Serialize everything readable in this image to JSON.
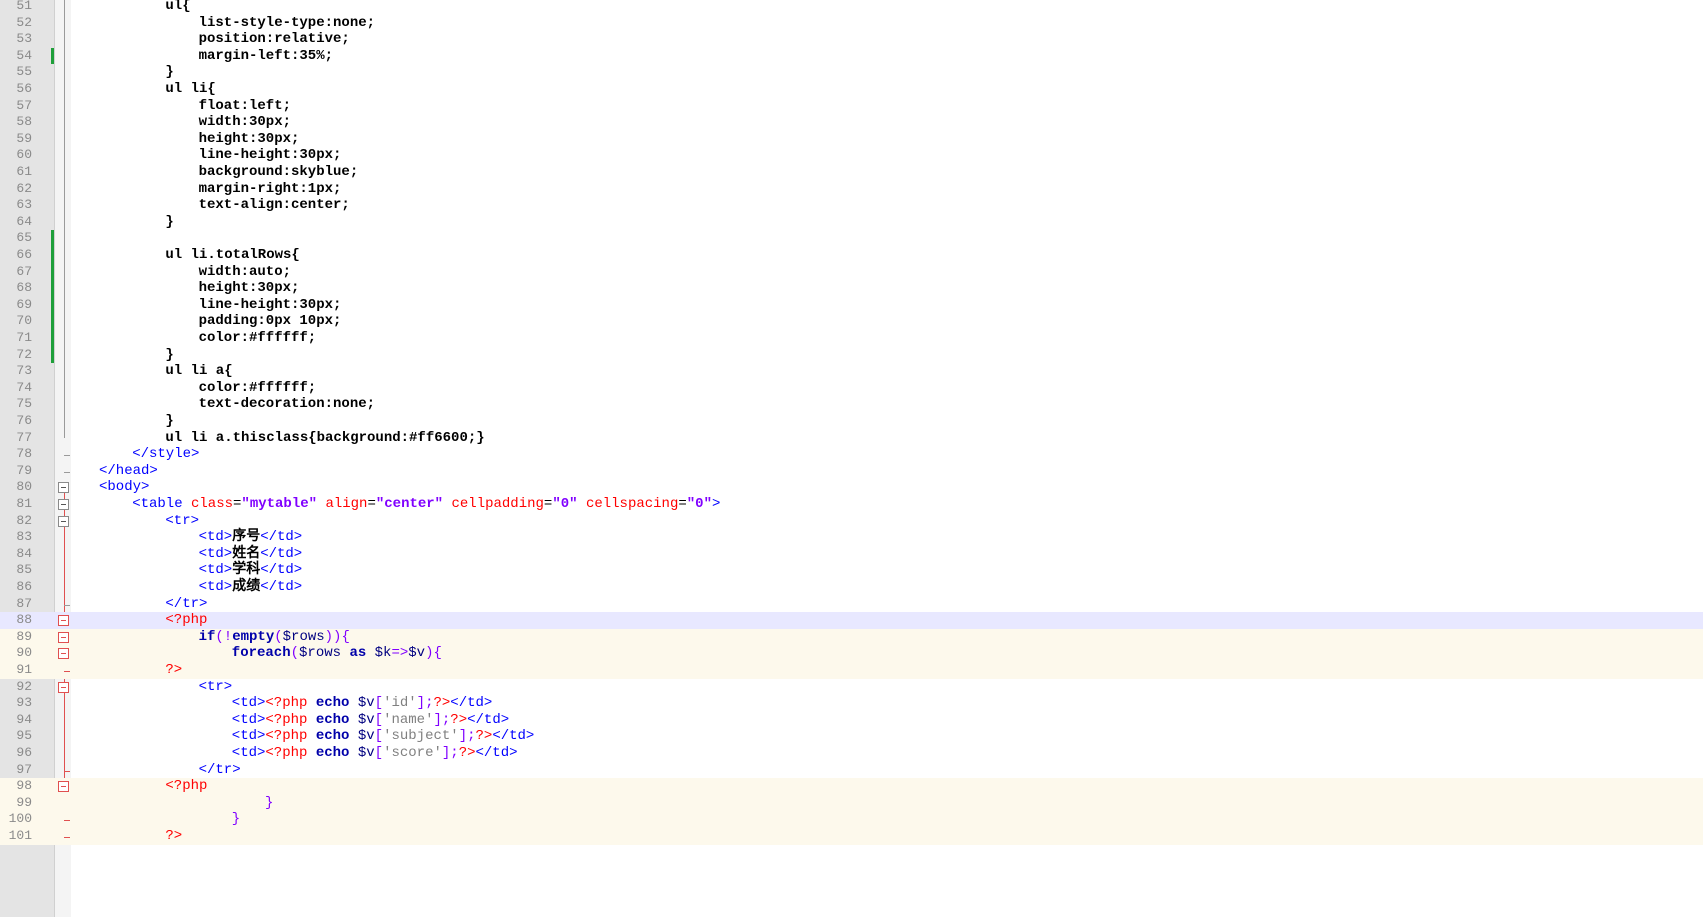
{
  "editor": {
    "lines": [
      {
        "n": "51",
        "indent": 4,
        "tokens": [
          {
            "t": "ul{",
            "c": "c-css"
          }
        ]
      },
      {
        "n": "52",
        "indent": 6,
        "tokens": [
          {
            "t": "list-style-type:none;",
            "c": "c-css"
          }
        ]
      },
      {
        "n": "53",
        "indent": 6,
        "tokens": [
          {
            "t": "position:relative;",
            "c": "c-css"
          }
        ]
      },
      {
        "n": "54",
        "indent": 6,
        "mark": true,
        "tokens": [
          {
            "t": "margin-left:35%;",
            "c": "c-css"
          }
        ]
      },
      {
        "n": "55",
        "indent": 4,
        "tokens": [
          {
            "t": "}",
            "c": "c-css"
          }
        ]
      },
      {
        "n": "56",
        "indent": 4,
        "tokens": [
          {
            "t": "ul li{",
            "c": "c-css"
          }
        ]
      },
      {
        "n": "57",
        "indent": 6,
        "tokens": [
          {
            "t": "float:left;",
            "c": "c-css"
          }
        ]
      },
      {
        "n": "58",
        "indent": 6,
        "tokens": [
          {
            "t": "width:30px;",
            "c": "c-css"
          }
        ]
      },
      {
        "n": "59",
        "indent": 6,
        "tokens": [
          {
            "t": "height:30px;",
            "c": "c-css"
          }
        ]
      },
      {
        "n": "60",
        "indent": 6,
        "tokens": [
          {
            "t": "line-height:30px;",
            "c": "c-css"
          }
        ]
      },
      {
        "n": "61",
        "indent": 6,
        "tokens": [
          {
            "t": "background:skyblue;",
            "c": "c-css"
          }
        ]
      },
      {
        "n": "62",
        "indent": 6,
        "tokens": [
          {
            "t": "margin-right:1px;",
            "c": "c-css"
          }
        ]
      },
      {
        "n": "63",
        "indent": 6,
        "tokens": [
          {
            "t": "text-align:center;",
            "c": "c-css"
          }
        ]
      },
      {
        "n": "64",
        "indent": 4,
        "tokens": [
          {
            "t": "}",
            "c": "c-css"
          }
        ]
      },
      {
        "n": "65",
        "indent": 0,
        "mark": true,
        "tokens": []
      },
      {
        "n": "66",
        "indent": 4,
        "mark": true,
        "tokens": [
          {
            "t": "ul li.totalRows{",
            "c": "c-css"
          }
        ]
      },
      {
        "n": "67",
        "indent": 6,
        "mark": true,
        "tokens": [
          {
            "t": "width:auto;",
            "c": "c-css"
          }
        ]
      },
      {
        "n": "68",
        "indent": 6,
        "mark": true,
        "tokens": [
          {
            "t": "height:30px;",
            "c": "c-css"
          }
        ]
      },
      {
        "n": "69",
        "indent": 6,
        "mark": true,
        "tokens": [
          {
            "t": "line-height:30px;",
            "c": "c-css"
          }
        ]
      },
      {
        "n": "70",
        "indent": 6,
        "mark": true,
        "tokens": [
          {
            "t": "padding:0px 10px;",
            "c": "c-css"
          }
        ]
      },
      {
        "n": "71",
        "indent": 6,
        "mark": true,
        "tokens": [
          {
            "t": "color:#ffffff;",
            "c": "c-css"
          }
        ]
      },
      {
        "n": "72",
        "indent": 4,
        "mark": true,
        "tokens": [
          {
            "t": "}",
            "c": "c-css"
          }
        ]
      },
      {
        "n": "73",
        "indent": 4,
        "tokens": [
          {
            "t": "ul li a{",
            "c": "c-css"
          }
        ]
      },
      {
        "n": "74",
        "indent": 6,
        "tokens": [
          {
            "t": "color:#ffffff;",
            "c": "c-css"
          }
        ]
      },
      {
        "n": "75",
        "indent": 6,
        "tokens": [
          {
            "t": "text-decoration:none;",
            "c": "c-css"
          }
        ]
      },
      {
        "n": "76",
        "indent": 4,
        "tokens": [
          {
            "t": "}",
            "c": "c-css"
          }
        ]
      },
      {
        "n": "77",
        "indent": 4,
        "tokens": [
          {
            "t": "ul li a.thisclass{background:#ff6600;}",
            "c": "c-css"
          }
        ]
      },
      {
        "n": "78",
        "indent": 2,
        "fold": "end",
        "tokens": [
          {
            "t": "</style>",
            "c": "c-tag"
          }
        ]
      },
      {
        "n": "79",
        "indent": 0,
        "fold": "end",
        "tokens": [
          {
            "t": "</head>",
            "c": "c-tag"
          }
        ]
      },
      {
        "n": "80",
        "indent": 0,
        "fold": "btn",
        "tokens": [
          {
            "t": "<body>",
            "c": "c-tag"
          }
        ]
      },
      {
        "n": "81",
        "indent": 2,
        "fold": "btn",
        "tokens": [
          {
            "t": "<table ",
            "c": "c-tag"
          },
          {
            "t": "class",
            "c": "c-attr"
          },
          {
            "t": "=",
            "c": "c-op"
          },
          {
            "t": "\"mytable\"",
            "c": "c-str"
          },
          {
            "t": " align",
            "c": "c-attr"
          },
          {
            "t": "=",
            "c": "c-op"
          },
          {
            "t": "\"center\"",
            "c": "c-str"
          },
          {
            "t": " cellpadding",
            "c": "c-attr"
          },
          {
            "t": "=",
            "c": "c-op"
          },
          {
            "t": "\"0\"",
            "c": "c-str"
          },
          {
            "t": " cellspacing",
            "c": "c-attr"
          },
          {
            "t": "=",
            "c": "c-op"
          },
          {
            "t": "\"0\"",
            "c": "c-str"
          },
          {
            "t": ">",
            "c": "c-tag"
          }
        ]
      },
      {
        "n": "82",
        "indent": 4,
        "fold": "btn",
        "tokens": [
          {
            "t": "<tr>",
            "c": "c-tag"
          }
        ]
      },
      {
        "n": "83",
        "indent": 6,
        "tokens": [
          {
            "t": "<td>",
            "c": "c-tag"
          },
          {
            "t": "序号",
            "c": "c-text"
          },
          {
            "t": "</td>",
            "c": "c-tag"
          }
        ]
      },
      {
        "n": "84",
        "indent": 6,
        "tokens": [
          {
            "t": "<td>",
            "c": "c-tag"
          },
          {
            "t": "姓名",
            "c": "c-text"
          },
          {
            "t": "</td>",
            "c": "c-tag"
          }
        ]
      },
      {
        "n": "85",
        "indent": 6,
        "tokens": [
          {
            "t": "<td>",
            "c": "c-tag"
          },
          {
            "t": "学科",
            "c": "c-text"
          },
          {
            "t": "</td>",
            "c": "c-tag"
          }
        ]
      },
      {
        "n": "86",
        "indent": 6,
        "tokens": [
          {
            "t": "<td>",
            "c": "c-tag"
          },
          {
            "t": "成绩",
            "c": "c-text"
          },
          {
            "t": "</td>",
            "c": "c-tag"
          }
        ]
      },
      {
        "n": "87",
        "indent": 4,
        "fold": "end",
        "tokens": [
          {
            "t": "</tr>",
            "c": "c-tag"
          }
        ]
      },
      {
        "n": "88",
        "indent": 4,
        "current": true,
        "fold": "btn-red",
        "tokens": [
          {
            "t": "<?php",
            "c": "c-php"
          }
        ]
      },
      {
        "n": "89",
        "indent": 6,
        "php": true,
        "fold": "btn-red",
        "tokens": [
          {
            "t": "if",
            "c": "c-kw"
          },
          {
            "t": "(!",
            "c": "c-punc"
          },
          {
            "t": "empty",
            "c": "c-kw"
          },
          {
            "t": "(",
            "c": "c-punc"
          },
          {
            "t": "$rows",
            "c": "c-var"
          },
          {
            "t": ")){",
            "c": "c-punc"
          }
        ]
      },
      {
        "n": "90",
        "indent": 8,
        "php": true,
        "fold": "btn-red",
        "tokens": [
          {
            "t": "foreach",
            "c": "c-kw"
          },
          {
            "t": "(",
            "c": "c-punc"
          },
          {
            "t": "$rows ",
            "c": "c-var"
          },
          {
            "t": "as",
            "c": "c-kw"
          },
          {
            "t": " $k",
            "c": "c-var"
          },
          {
            "t": "=>",
            "c": "c-punc"
          },
          {
            "t": "$v",
            "c": "c-var"
          },
          {
            "t": "){",
            "c": "c-punc"
          }
        ]
      },
      {
        "n": "91",
        "indent": 4,
        "php": true,
        "fold": "end-red",
        "tokens": [
          {
            "t": "?>",
            "c": "c-php"
          }
        ]
      },
      {
        "n": "92",
        "indent": 6,
        "fold": "btn-red",
        "tokens": [
          {
            "t": "<tr>",
            "c": "c-tag"
          }
        ]
      },
      {
        "n": "93",
        "indent": 8,
        "tokens": [
          {
            "t": "<td>",
            "c": "c-tag"
          },
          {
            "t": "<?php",
            "c": "c-php"
          },
          {
            "t": " echo",
            "c": "c-kw"
          },
          {
            "t": " $v",
            "c": "c-var"
          },
          {
            "t": "[",
            "c": "c-punc"
          },
          {
            "t": "'id'",
            "c": "c-pstr"
          },
          {
            "t": "];",
            "c": "c-punc"
          },
          {
            "t": "?>",
            "c": "c-php"
          },
          {
            "t": "</td>",
            "c": "c-tag"
          }
        ]
      },
      {
        "n": "94",
        "indent": 8,
        "tokens": [
          {
            "t": "<td>",
            "c": "c-tag"
          },
          {
            "t": "<?php",
            "c": "c-php"
          },
          {
            "t": " echo",
            "c": "c-kw"
          },
          {
            "t": " $v",
            "c": "c-var"
          },
          {
            "t": "[",
            "c": "c-punc"
          },
          {
            "t": "'name'",
            "c": "c-pstr"
          },
          {
            "t": "];",
            "c": "c-punc"
          },
          {
            "t": "?>",
            "c": "c-php"
          },
          {
            "t": "</td>",
            "c": "c-tag"
          }
        ]
      },
      {
        "n": "95",
        "indent": 8,
        "tokens": [
          {
            "t": "<td>",
            "c": "c-tag"
          },
          {
            "t": "<?php",
            "c": "c-php"
          },
          {
            "t": " echo",
            "c": "c-kw"
          },
          {
            "t": " $v",
            "c": "c-var"
          },
          {
            "t": "[",
            "c": "c-punc"
          },
          {
            "t": "'subject'",
            "c": "c-pstr"
          },
          {
            "t": "];",
            "c": "c-punc"
          },
          {
            "t": "?>",
            "c": "c-php"
          },
          {
            "t": "</td>",
            "c": "c-tag"
          }
        ]
      },
      {
        "n": "96",
        "indent": 8,
        "tokens": [
          {
            "t": "<td>",
            "c": "c-tag"
          },
          {
            "t": "<?php",
            "c": "c-php"
          },
          {
            "t": " echo",
            "c": "c-kw"
          },
          {
            "t": " $v",
            "c": "c-var"
          },
          {
            "t": "[",
            "c": "c-punc"
          },
          {
            "t": "'score'",
            "c": "c-pstr"
          },
          {
            "t": "];",
            "c": "c-punc"
          },
          {
            "t": "?>",
            "c": "c-php"
          },
          {
            "t": "</td>",
            "c": "c-tag"
          }
        ]
      },
      {
        "n": "97",
        "indent": 6,
        "fold": "end-red",
        "tokens": [
          {
            "t": "</tr>",
            "c": "c-tag"
          }
        ]
      },
      {
        "n": "98",
        "indent": 4,
        "php": true,
        "fold": "btn-red",
        "tokens": [
          {
            "t": "<?php",
            "c": "c-php"
          }
        ]
      },
      {
        "n": "99",
        "indent": 10,
        "php": true,
        "tokens": [
          {
            "t": "}",
            "c": "c-punc"
          }
        ]
      },
      {
        "n": "100",
        "indent": 8,
        "php": true,
        "fold": "end-red",
        "tokens": [
          {
            "t": "}",
            "c": "c-punc"
          }
        ]
      },
      {
        "n": "101",
        "indent": 4,
        "php": true,
        "fold": "end-red",
        "tokens": [
          {
            "t": "?>",
            "c": "c-php"
          }
        ]
      }
    ]
  }
}
